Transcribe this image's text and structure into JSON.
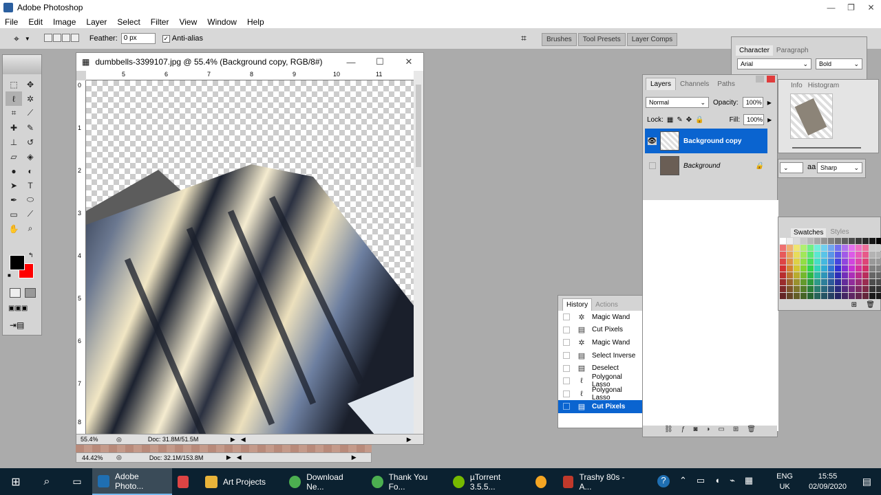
{
  "window": {
    "title": "Adobe Photoshop",
    "minimize": "—",
    "restore": "❐",
    "close": "✕"
  },
  "menu": [
    "File",
    "Edit",
    "Image",
    "Layer",
    "Select",
    "Filter",
    "View",
    "Window",
    "Help"
  ],
  "options": {
    "feather_label": "Feather:",
    "feather_value": "0 px",
    "antialias_label": "Anti-alias",
    "antialias_checked": true
  },
  "tabwell": [
    "Brushes",
    "Tool Presets",
    "Layer Comps"
  ],
  "document": {
    "title": "dumbbells-3399107.jpg @ 55.4% (Background copy, RGB/8#)",
    "ruler_top": [
      "5",
      "6",
      "7",
      "8",
      "9",
      "10",
      "11"
    ],
    "ruler_left": [
      "0",
      "1",
      "2",
      "3",
      "4",
      "5",
      "6",
      "7",
      "8"
    ],
    "zoom": "55.4%",
    "doc_info": "Doc: 31.8M/51.5M"
  },
  "document2": {
    "zoom": "44.42%",
    "doc_info": "Doc: 32.1M/153.8M"
  },
  "history": {
    "tabs": [
      "History",
      "Actions"
    ],
    "items": [
      {
        "label": "Magic Wand",
        "icon": "magic-wand-icon"
      },
      {
        "label": "Cut Pixels",
        "icon": "layer-icon"
      },
      {
        "label": "Magic Wand",
        "icon": "magic-wand-icon"
      },
      {
        "label": "Select Inverse",
        "icon": "layer-icon"
      },
      {
        "label": "Deselect",
        "icon": "layer-icon"
      },
      {
        "label": "Polygonal Lasso",
        "icon": "lasso-icon"
      },
      {
        "label": "Polygonal Lasso",
        "icon": "lasso-icon"
      },
      {
        "label": "Cut Pixels",
        "icon": "layer-icon",
        "selected": true
      }
    ]
  },
  "layers": {
    "tabs": [
      "Layers",
      "Channels",
      "Paths"
    ],
    "blend_mode": "Normal",
    "opacity_label": "Opacity:",
    "opacity_value": "100%",
    "lock_label": "Lock:",
    "fill_label": "Fill:",
    "fill_value": "100%",
    "items": [
      {
        "name": "Background copy",
        "selected": true,
        "visible": true
      },
      {
        "name": "Background",
        "selected": false,
        "visible": false,
        "locked": true
      }
    ]
  },
  "character": {
    "tabs": [
      "Character",
      "Paragraph"
    ],
    "font": "Arial",
    "style": "Bold",
    "antialias_prefix": "aa",
    "antialias": "Sharp"
  },
  "navigator": {
    "tabs": [
      "Info",
      "Histogram"
    ]
  },
  "swatches": {
    "tabs": [
      "Swatches",
      "Styles"
    ]
  },
  "taskbar": {
    "items": [
      {
        "label": "Adobe Photo...",
        "color": "#1f6fb2",
        "active": true
      },
      {
        "label": "",
        "color": "#d44",
        "active": false
      },
      {
        "label": "Art Projects",
        "color": "#e8b43a",
        "active": false
      },
      {
        "label": "Download Ne...",
        "color": "#4caf50",
        "active": false
      },
      {
        "label": "Thank You Fo...",
        "color": "#4caf50",
        "active": false
      },
      {
        "label": "µTorrent 3.5.5...",
        "color": "#76b900",
        "active": false
      },
      {
        "label": "",
        "color": "#f5a623",
        "active": false
      },
      {
        "label": "Trashy 80s - A...",
        "color": "#c0392b",
        "active": false
      }
    ],
    "lang_top": "ENG",
    "lang_bottom": "UK",
    "time": "15:55",
    "date": "02/09/2020"
  },
  "colors": {
    "selection": "#0a64d0",
    "taskbar": "#0b2130",
    "foreground": "#000000",
    "background": "#ff0000"
  }
}
